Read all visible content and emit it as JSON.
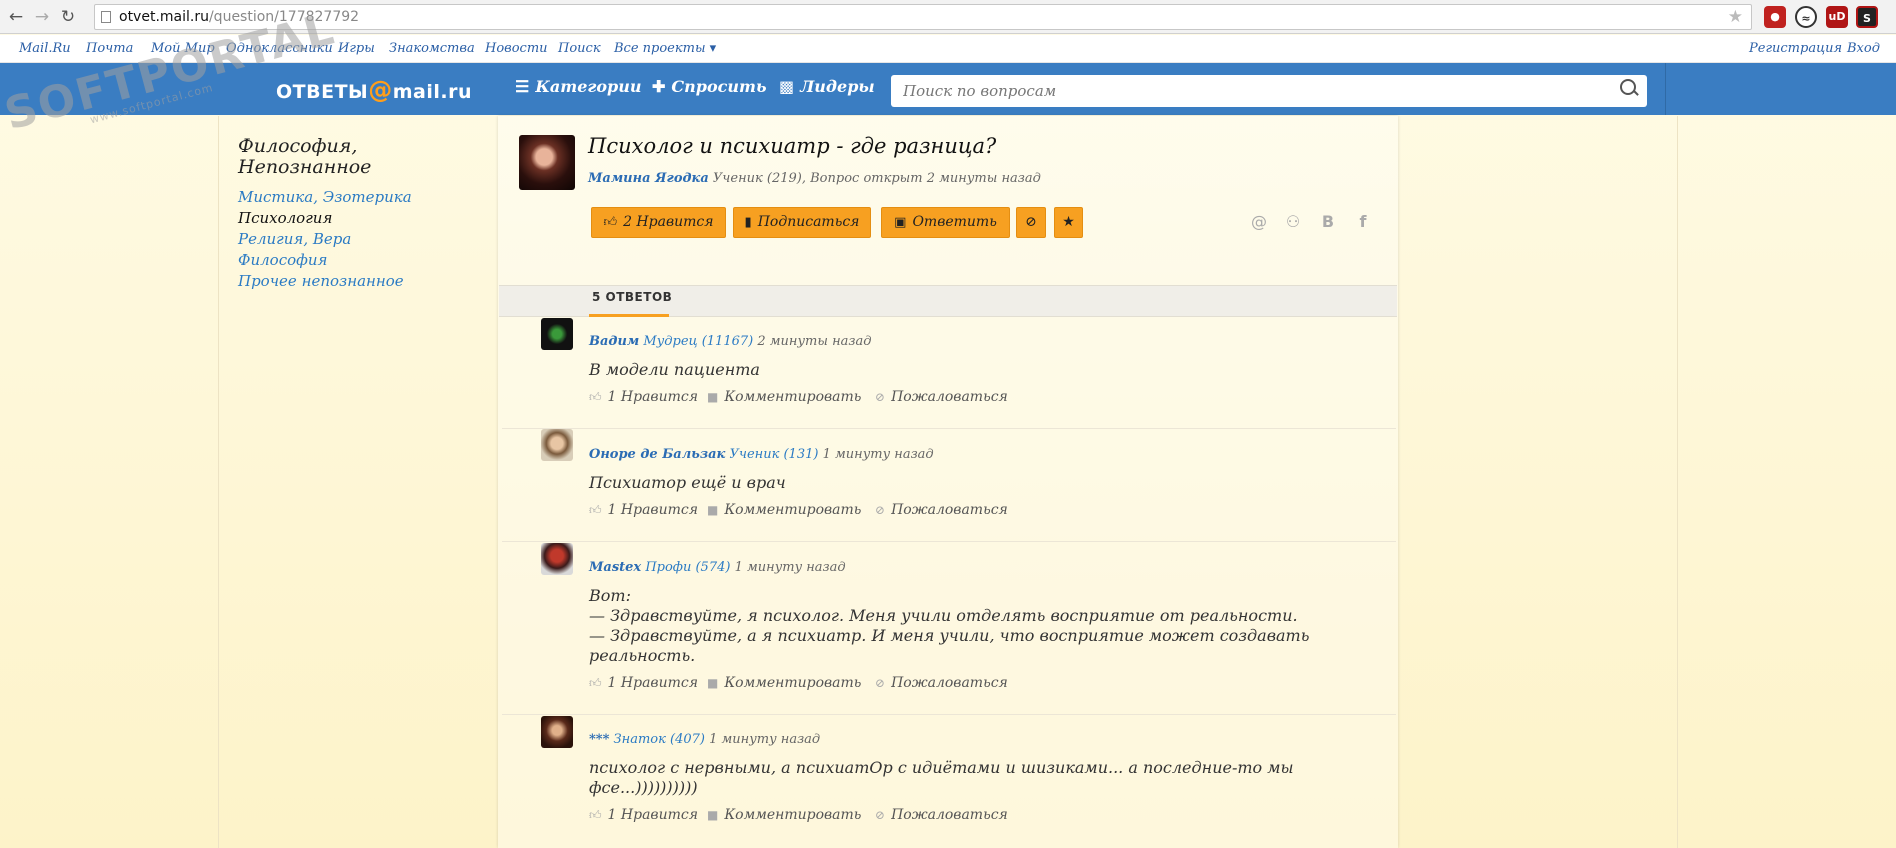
{
  "browser": {
    "url_host": "otvet.mail.ru",
    "url_path": "/question/177827792"
  },
  "portal_nav": {
    "items": [
      "Mail.Ru",
      "Почта",
      "Мой Мир",
      "Одноклассники",
      "Игры",
      "Знакомства",
      "Новости",
      "Поиск",
      "Все проекты ▾"
    ],
    "register": "Регистрация",
    "login": "Вход"
  },
  "watermark": {
    "brand": "SOFTPORTAL",
    "url": "www.softportal.com"
  },
  "header": {
    "logo_left": "ОТВЕТЫ",
    "logo_at": "@",
    "logo_right": "mail.ru",
    "categories": "Категории",
    "ask": "Спросить",
    "leaders": "Лидеры",
    "search_placeholder": "Поиск по вопросам"
  },
  "sidebar": {
    "title": "Философия, Непознанное",
    "links": [
      "Мистика, Эзотерика",
      "Психология",
      "Религия, Вера",
      "Философия",
      "Прочее непознанное"
    ]
  },
  "question": {
    "title": "Психолог и психиатр - где разница?",
    "author": "Мамина Ягодка",
    "meta": "Ученик (219), Вопрос открыт 2 минуты назад",
    "like_label": "2 Нравится",
    "subscribe_label": "Подписаться",
    "answer_label": "Ответить"
  },
  "answers_tab": "5 ОТВЕТОВ",
  "answers": [
    {
      "author": "Вадим",
      "rank": "Мудрец (11167)",
      "time": "2 минуты назад",
      "text": "В модели пациента",
      "likes": "1 Нравится",
      "comment": "Комментировать",
      "report": "Пожаловаться"
    },
    {
      "author": "Оноре де Бальзак",
      "rank": "Ученик (131)",
      "time": "1 минуту назад",
      "text": "Психиатор ещё и врач",
      "likes": "1 Нравится",
      "comment": "Комментировать",
      "report": "Пожаловаться"
    },
    {
      "author": "Mastex",
      "rank": "Профи (574)",
      "time": "1 минуту назад",
      "text": "Вот:\n— Здравствуйте, я психолог. Меня учили отделять восприятие от реальности.\n— Здравствуйте, а я психиатр. И меня учили, что восприятие может создавать реальность.",
      "likes": "1 Нравится",
      "comment": "Комментировать",
      "report": "Пожаловаться"
    },
    {
      "author": "***",
      "rank": "Знаток (407)",
      "time": "1 минуту назад",
      "text": "психолог с нервными, а психиатОр с идиётами и шизиками... а последние-то мы фсе...))))))))))",
      "likes": "1 Нравится",
      "comment": "Комментировать",
      "report": "Пожаловаться"
    }
  ],
  "colors": {
    "header_blue": "#3a7dc2",
    "accent_orange": "#f7a021",
    "link_blue": "#2b6cb4"
  }
}
